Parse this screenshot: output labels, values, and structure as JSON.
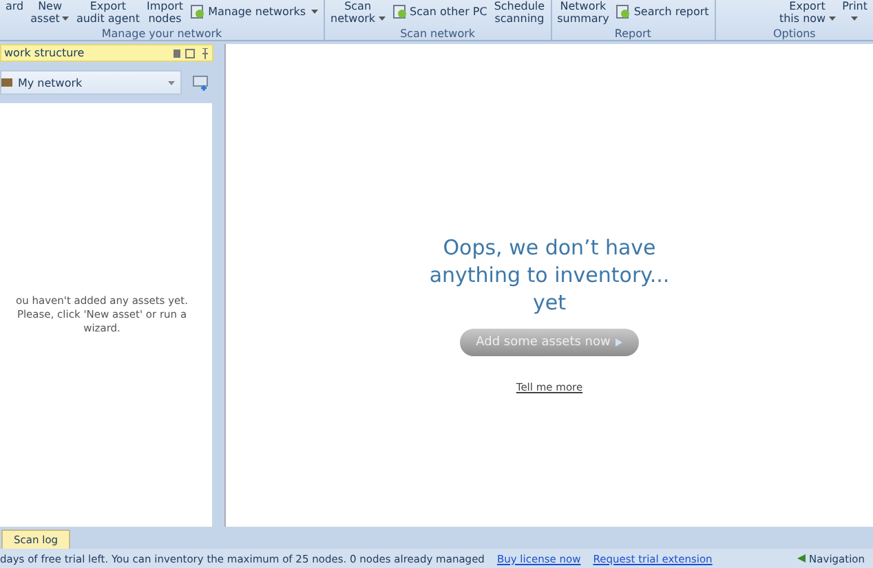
{
  "ribbon": {
    "groups": [
      {
        "label": "Manage your network",
        "buttons": [
          {
            "kind": "big",
            "lines": [
              "ard"
            ],
            "caret": false
          },
          {
            "kind": "big",
            "lines": [
              "New",
              "asset"
            ],
            "caret": true
          },
          {
            "kind": "big",
            "lines": [
              "Export",
              "audit agent"
            ],
            "caret": false
          },
          {
            "kind": "big",
            "lines": [
              "Import",
              "nodes"
            ],
            "caret": false
          },
          {
            "kind": "small",
            "lines": [
              "Manage networks"
            ],
            "caret": true
          }
        ]
      },
      {
        "label": "Scan network",
        "buttons": [
          {
            "kind": "big",
            "lines": [
              "Scan",
              "network"
            ],
            "caret": true
          },
          {
            "kind": "small",
            "lines": [
              "Scan other PC"
            ],
            "caret": false
          },
          {
            "kind": "big",
            "lines": [
              "Schedule",
              "scanning"
            ],
            "caret": false
          }
        ]
      },
      {
        "label": "Report",
        "buttons": [
          {
            "kind": "big",
            "lines": [
              "Network",
              "summary"
            ],
            "caret": false
          },
          {
            "kind": "small",
            "lines": [
              "Search report"
            ],
            "caret": false
          }
        ]
      },
      {
        "label": "Options",
        "buttons": [
          {
            "kind": "big",
            "lines": [
              "Export",
              "this now"
            ],
            "caret": true
          },
          {
            "kind": "big",
            "lines": [
              "Print"
            ],
            "caret": true
          }
        ]
      }
    ]
  },
  "sidebar": {
    "title": "work structure",
    "network": "My network",
    "empty_message": "ou haven't added any assets yet. Please, click 'New asset' or run a wizard."
  },
  "main": {
    "headline": "Oops, we don’t have anything to inventory... yet",
    "button": "Add some assets now",
    "link": "Tell me more"
  },
  "bottom_tabs": [
    {
      "label": "Scan log",
      "selected": true
    }
  ],
  "status_bar": {
    "message": "days of free trial left. You can inventory the maximum of 25 nodes. 0 nodes already managed",
    "links": [
      "Buy license now",
      "Request trial extension"
    ],
    "navigation": "Navigation"
  }
}
